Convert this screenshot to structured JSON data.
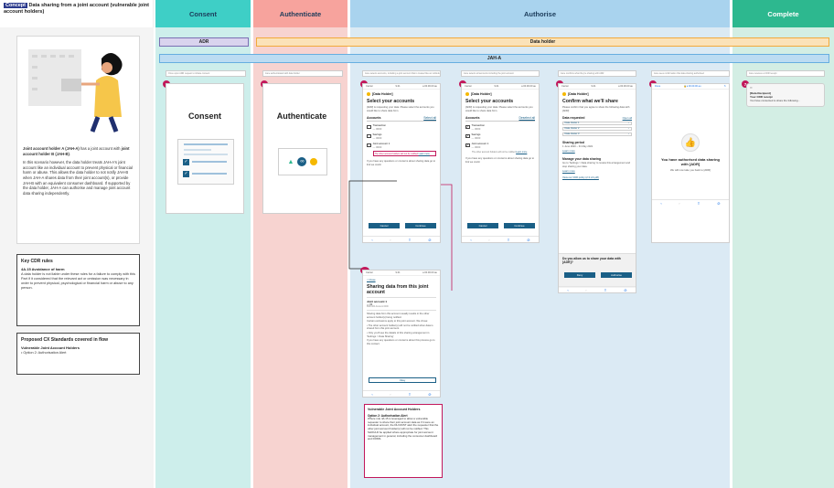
{
  "concept": {
    "tag": "Concept",
    "title": "Data sharing from a joint account (vulnerable joint account holders)"
  },
  "columns": {
    "consent": "Consent",
    "authenticate": "Authenticate",
    "authorise": "Authorise",
    "complete": "Complete"
  },
  "colors": {
    "consent": "#3ecfc6",
    "consent_bg": "#cdeeeb",
    "authenticate": "#f7a39d",
    "authenticate_bg": "#f7d3d0",
    "authorise": "#a9d3ee",
    "authorise_bg": "#dbeaf4",
    "complete": "#2db88f",
    "complete_bg": "#d3eee4",
    "adr_bar": "#7b6fb3",
    "holder_bar": "#f2a93b",
    "jah_bar": "#66aee0",
    "badge": "#c2185b"
  },
  "bars": {
    "adr": "ADR",
    "data_holder": "Data holder",
    "jah_a": "JAH-A"
  },
  "intro": {
    "p1_parts": [
      "Joint account holder A (JAH-A)",
      " has a joint account with ",
      "joint account holder B (JAH-B)",
      "."
    ],
    "p2": "In this scenario however, the data holder treats JAH-A's joint account like an individual account to prevent physical or financial harm or abuse. This allows the data holder to not notify JAH-B when JAH-A shares data from their joint account(s), or provide JAH-B with an equivalent consumer dashboard. If supported by the data holder, JAH-A can authorise and manage joint account data sharing independently."
  },
  "cdr_rules": {
    "title": "Key CDR rules",
    "subtitle": "4A.15 Avoidance of harm",
    "text": "A data holder is not liable under these rules for a failure to comply with this Part if it considered that the relevant act or omission was necessary in order to prevent physical, psychological or financial harm or abuse to any person."
  },
  "cx_standards": {
    "title": "Proposed CX Standards covered in flow",
    "subtitle": "Vulnerable Joint Account Holders",
    "item": "Option 2: Authorisation Alert"
  },
  "screens": {
    "s1": {
      "badge": "1",
      "caption": "Once upon ADR request to initiate consent",
      "title": "Consent"
    },
    "s2": {
      "badge": "2",
      "caption": "Jane authenticated with data holder",
      "title": "Authenticate"
    },
    "s3": {
      "badge": "3",
      "caption": "Jane selects accounts, including a joint account that is treated like an individual account",
      "holder": "[Data Holder]",
      "title": "Select your accounts",
      "intro": "[ADR] is requesting your data. Please select the accounts you would like to share data from.",
      "accounts_label": "Accounts",
      "select_all": "Select all",
      "rows": [
        {
          "name": "Transaction",
          "num": "— 0000",
          "checked": false
        },
        {
          "name": "Savings",
          "num": "— 0000",
          "checked": false
        },
        {
          "name": "Joint account 1",
          "num": "— 0000",
          "checked": false
        }
      ],
      "alert": "The other account holders will not be notified",
      "learn_more": "Learn more",
      "help": "If you have any questions or concerns about sharing data go to link we could.",
      "cancel": "Cancel",
      "continue": "Continue"
    },
    "s3a": {
      "badge": "3a",
      "back": "< Close",
      "title": "Sharing data from this joint account",
      "acct_name": "Joint account 1",
      "acct_num": "— 00",
      "acct_sub": "BSB 000 Account 0000",
      "p1": "Sharing data from this account usually results in the other account holder(s) being notified.",
      "p2": "Certain exclusions apply to this joint account. We chose:",
      "b1": "The other account holder(s) will not be notified when data is shared from this joint account.",
      "b2": "Only you'll see the details of this sharing arrangement in 'Settings > Data Sharing'",
      "p3": "If you have any questions or concerns about this process go to this contact.",
      "okay": "Okay"
    },
    "s4": {
      "badge": "4",
      "caption": "Jane selects all accounts including the joint account",
      "holder": "[Data Holder]",
      "title": "Select your accounts",
      "intro": "[ADR] is requesting your data. Please select the accounts you would like to share data from.",
      "accounts_label": "Accounts",
      "select_all": "Deselect all",
      "rows": [
        {
          "name": "Transaction",
          "num": "— 0000",
          "checked": true
        },
        {
          "name": "Savings",
          "num": "— 0000",
          "checked": true
        },
        {
          "name": "Joint account 1",
          "num": "— 0000",
          "checked": true
        }
      ],
      "alert": "The other account holders will not be notified",
      "learn_more": "Learn more",
      "help": "If you have any questions or concerns about sharing data go to link we could.",
      "cancel": "Cancel",
      "continue": "Continue"
    },
    "s5": {
      "badge": "5",
      "caption": "Jane confirms what they're sharing with ADR",
      "holder": "[Data Holder]",
      "title": "Confirm what we'll share",
      "intro": "Please confirm that you agree to share the following data with [ADR]:",
      "requested_label": "Data requested",
      "open_all": "Open all",
      "clusters": [
        "Data cluster 1",
        "Data cluster 2",
        "Data cluster 3"
      ],
      "period_label": "Sharing period",
      "period": "1 June 2020 – 31 May 2021",
      "learn_more": "Learn more",
      "manage_label": "Manage your data sharing",
      "manage_text": "Go to 'Settings > Data sharing' to review this arrangement and stop sharing your data.",
      "learn_more2": "Learn more",
      "policy": "View our CDR policy (2.3 mb pdf)",
      "question": "Do you allow us to share your data with [ADR]?",
      "deny": "Deny",
      "authorise": "Authorise"
    },
    "s6": {
      "badge": "6",
      "caption": "Jane sees confirmation that data sharing authorised",
      "done": "Done",
      "url": "a 00.00.00 au",
      "title": "You have authorised data sharing with [ADR]",
      "sub": "We will now take you back to [ADR]"
    },
    "s7": {
      "badge": "7",
      "caption": "Jane receives a CDR receipt",
      "from": "[Data Recipient]",
      "subject": "Your CDR receipt",
      "preview": "You have consented to share the following..."
    }
  },
  "callout": {
    "title": "Vulnerable Joint Account Holders",
    "subtitle": "Option 2: Authorisation Alert",
    "text": "Where rule 4A.15 is leveraged to allow a vulnerable requester to share their joint account data as if it were an individual account, the DH MUST alert the requester that the other joint account holder(s) will not be notified. This SHOULD be applied where appropriate for joint account management in general, including the consumer dashboard and DOMS."
  },
  "phone_status": {
    "time": "9:41",
    "carrier": "Carrier",
    "url": "a 00.00.00 au",
    "done": "Done"
  }
}
